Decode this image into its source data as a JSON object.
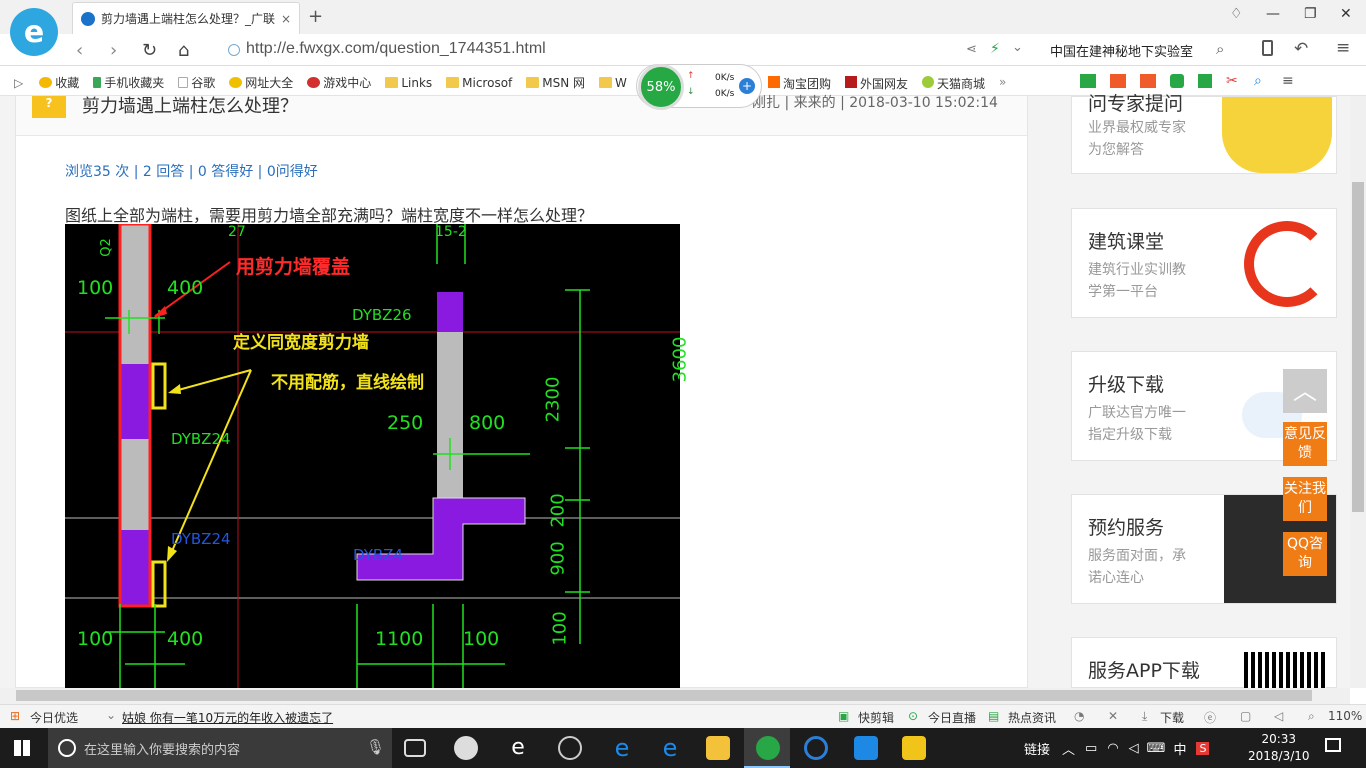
{
  "browser": {
    "tab_title": "剪力墙遇上端柱怎么处理？_广联",
    "new_tab": "+",
    "address": "http://e.fwxgx.com/question_1744351.html",
    "search_text": "中国在建神秘地下实验室",
    "bookmarks": [
      "收藏",
      "手机收藏夹",
      "谷歌",
      "网址大全",
      "游戏中心",
      "Links",
      "Microsof",
      "MSN 网",
      "W"
    ],
    "bookmarks_right": [
      "淘宝团购",
      "外国网友",
      "天猫商城"
    ],
    "speed": {
      "percent": "58%",
      "up": "0K/s",
      "down": "0K/s"
    }
  },
  "question": {
    "title": "剪力墙遇上端柱怎么处理？",
    "meta": "刚扎 | 来来的 | 2018-03-10 15:02:14",
    "stats": "浏览35 次 | 2 回答 | 0 答得好 | 0问得好",
    "body": "图纸上全部为端柱，需要用剪力墙全部充满吗？端柱宽度不一样怎么处理？"
  },
  "cad": {
    "annotation_red": "用剪力墙覆盖",
    "annotation_yellow1": "定义同宽度剪力墙",
    "annotation_yellow2": "不用配筋，直线绘制",
    "labels": [
      "Q2",
      "27",
      "15-2",
      "100",
      "400",
      "DYBZ26",
      "DYBZ24",
      "250",
      "800",
      "2300",
      "3600",
      "DYBZ24",
      "DYBZ4",
      "200",
      "900",
      "100",
      "100",
      "400",
      "1100",
      "100"
    ]
  },
  "sidebar": {
    "cards": [
      {
        "title": "问专家提问",
        "desc": [
          "业界最权威专家",
          "为您解答"
        ]
      },
      {
        "title": "建筑课堂",
        "desc": [
          "建筑行业实训教",
          "学第一平台"
        ]
      },
      {
        "title": "升级下载",
        "desc": [
          "广联达官方唯一",
          "指定升级下载"
        ]
      },
      {
        "title": "预约服务",
        "desc": [
          "服务面对面，承",
          "诺心连心"
        ]
      },
      {
        "title": "服务APP下载",
        "desc": []
      }
    ],
    "tools": [
      "意见反馈",
      "关注我们",
      "QQ咨询"
    ]
  },
  "statusbar": {
    "left": "今日优选",
    "news": "姑娘 你有一笔10万元的年收入被遗忘了",
    "items": [
      "快剪辑",
      "今日直播",
      "热点资讯",
      "下载"
    ],
    "zoom": "110%"
  },
  "taskbar": {
    "search_placeholder": "在这里输入你要搜索的内容",
    "tray_label": "链接",
    "ime": "中",
    "time": "20:33",
    "date": "2018/3/10"
  },
  "colors": {
    "accent": "#2ea7e0",
    "link": "#2a6fbc",
    "orange": "#f07c16"
  }
}
